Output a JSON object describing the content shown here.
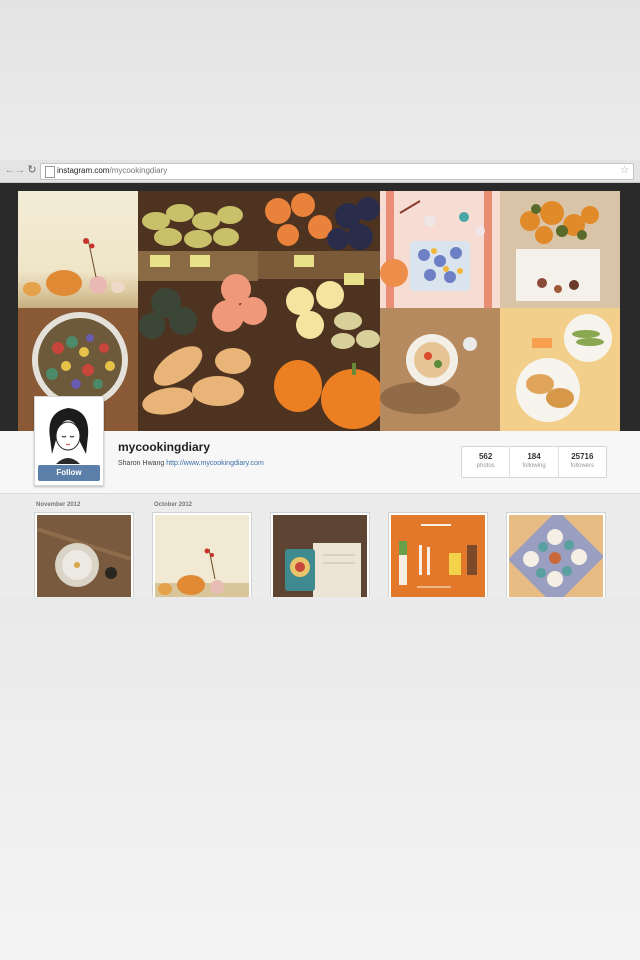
{
  "browser": {
    "url_domain": "instagram.com",
    "url_path": "/mycookingdiary"
  },
  "profile": {
    "username": "mycookingdiary",
    "full_name": "Sharon Hwang",
    "website": "http://www.mycookingdiary.com",
    "follow_label": "Follow",
    "stats": [
      {
        "value": "562",
        "label": "photos"
      },
      {
        "value": "184",
        "label": "following"
      },
      {
        "value": "25716",
        "label": "followers"
      }
    ]
  },
  "feed": {
    "months": [
      "November 2012",
      "October 2012"
    ]
  },
  "icons": [
    "back-arrow-icon",
    "forward-arrow-icon",
    "reload-icon",
    "page-icon",
    "bookmark-star-icon"
  ],
  "colors": {
    "follow_button": "#5b7fa8",
    "link": "#3a6fa8"
  }
}
